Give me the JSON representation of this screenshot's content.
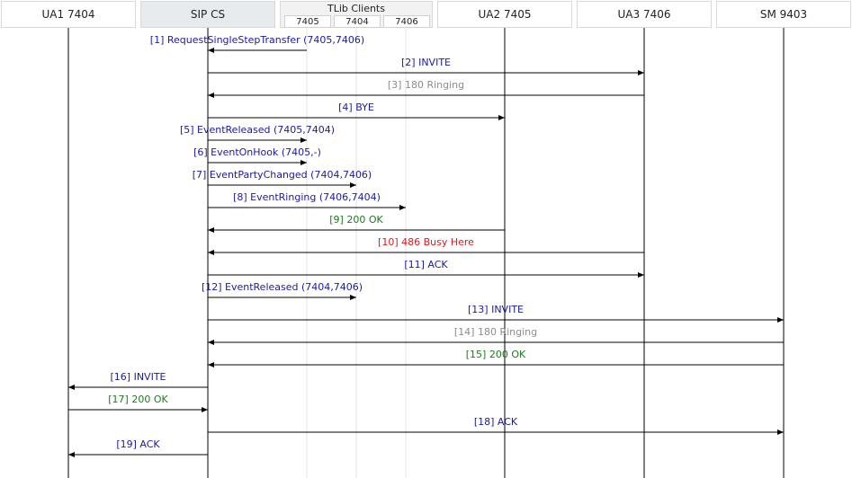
{
  "participants": {
    "ua1": "UA1 7404",
    "sip": "SIP CS",
    "tlib": "TLib Clients",
    "tlib_7405": "7405",
    "tlib_7404": "7404",
    "tlib_7406": "7406",
    "ua2": "UA2 7405",
    "ua3": "UA3 7406",
    "sm": "SM  9403"
  },
  "colors": {
    "blue": "#1a1aa6",
    "gray": "#8c8c8c",
    "green": "#1e7a1e",
    "red": "#e0191b"
  },
  "messages": [
    {
      "label": "[1] RequestSingleStepTransfer (7405,7406)",
      "from": "t7405",
      "to": "sip",
      "color": "blue"
    },
    {
      "label": "[2] INVITE",
      "from": "sip",
      "to": "ua3",
      "color": "blue"
    },
    {
      "label": "[3] 180 Ringing",
      "from": "ua3",
      "to": "sip",
      "color": "gray"
    },
    {
      "label": "[4] BYE",
      "from": "sip",
      "to": "ua2",
      "color": "blue"
    },
    {
      "label": "[5] EventReleased (7405,7404)",
      "from": "sip",
      "to": "t7405",
      "color": "blue"
    },
    {
      "label": "[6] EventOnHook (7405,-)",
      "from": "sip",
      "to": "t7405",
      "color": "blue"
    },
    {
      "label": "[7] EventPartyChanged (7404,7406)",
      "from": "sip",
      "to": "t7404",
      "color": "blue"
    },
    {
      "label": "[8] EventRinging (7406,7404)",
      "from": "sip",
      "to": "t7406",
      "color": "blue"
    },
    {
      "label": "[9] 200 OK",
      "from": "ua2",
      "to": "sip",
      "color": "green"
    },
    {
      "label": "[10] 486 Busy Here",
      "from": "ua3",
      "to": "sip",
      "color": "red"
    },
    {
      "label": "[11] ACK",
      "from": "sip",
      "to": "ua3",
      "color": "blue"
    },
    {
      "label": "[12] EventReleased (7404,7406)",
      "from": "sip",
      "to": "t7404",
      "color": "blue"
    },
    {
      "label": "[13] INVITE",
      "from": "sip",
      "to": "sm",
      "color": "blue"
    },
    {
      "label": "[14] 180 Ringing",
      "from": "sm",
      "to": "sip",
      "color": "gray"
    },
    {
      "label": "[15] 200 OK",
      "from": "sm",
      "to": "sip",
      "color": "green"
    },
    {
      "label": "[16] INVITE",
      "from": "sip",
      "to": "ua1",
      "color": "blue"
    },
    {
      "label": "[17] 200 OK",
      "from": "ua1",
      "to": "sip",
      "color": "green"
    },
    {
      "label": "[18] ACK",
      "from": "sip",
      "to": "sm",
      "color": "blue"
    },
    {
      "label": "[19] ACK",
      "from": "sip",
      "to": "ua1",
      "color": "blue"
    }
  ]
}
